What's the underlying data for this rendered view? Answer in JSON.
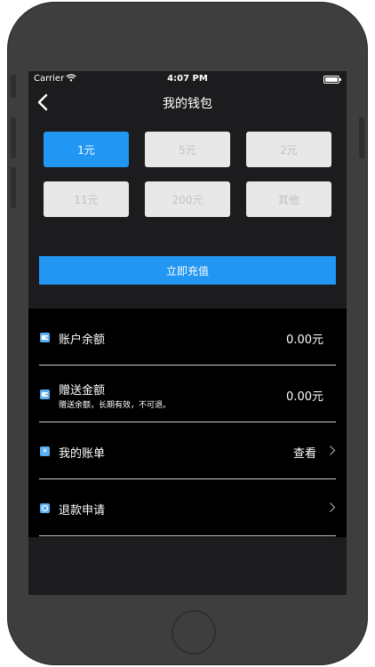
{
  "status_bar": {
    "carrier": "Carrier",
    "time": "4:07 PM"
  },
  "nav": {
    "title": "我的钱包"
  },
  "amounts": [
    "1元",
    "5元",
    "2元",
    "11元",
    "200元",
    "其他"
  ],
  "selected_amount": "1元",
  "recharge_label": "立即充值",
  "list": {
    "balance": {
      "label": "账户余额",
      "value": "0.00元",
      "icon": "wallet-icon"
    },
    "bonus": {
      "label": "赠送金额",
      "sub": "赠送余额，长期有效，不可退。",
      "value": "0.00元",
      "icon": "wallet-icon"
    },
    "bills": {
      "label": "我的账单",
      "value": "查看",
      "icon": "yen-icon",
      "icon_glyph": "¥"
    },
    "refund": {
      "label": "退款申请",
      "icon": "refresh-icon"
    }
  },
  "colors": {
    "accent": "#2196f3",
    "screen_bg": "#1c1c1e",
    "list_bg": "#000000",
    "unselected_btn": "#e8e8e8"
  }
}
